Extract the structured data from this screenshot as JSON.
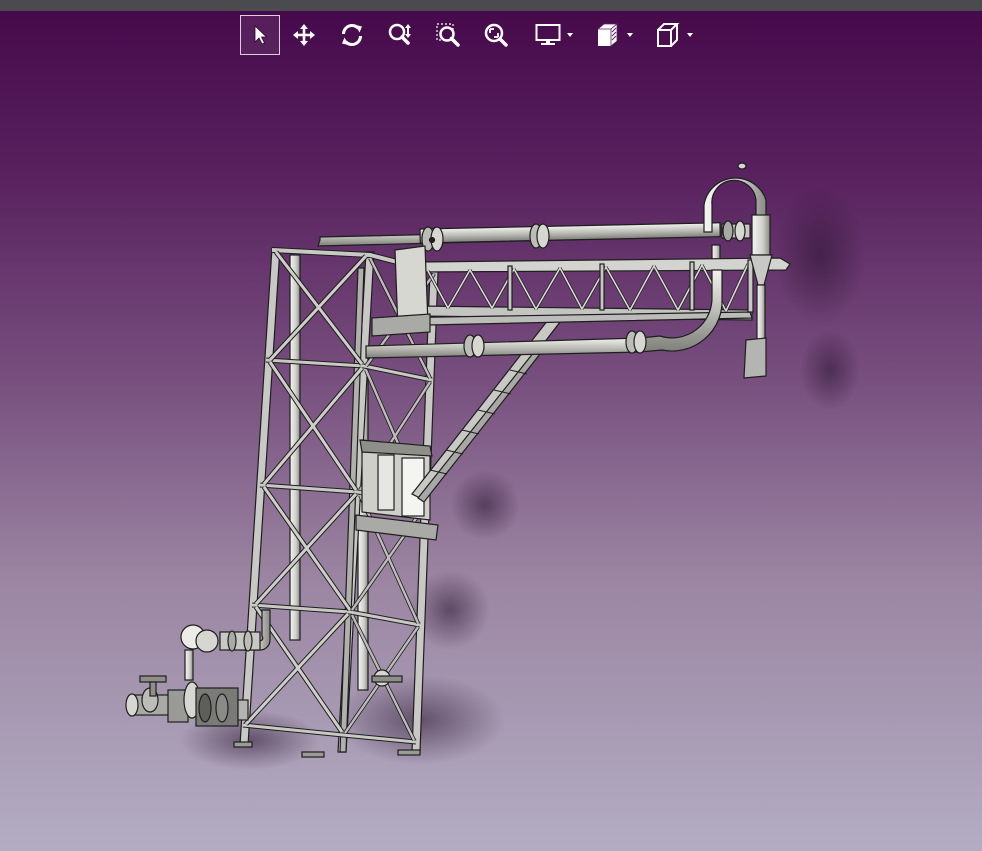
{
  "toolbar": {
    "tools": [
      {
        "name": "select",
        "icon": "pointer-arrow-icon",
        "selected": true
      },
      {
        "name": "pan",
        "icon": "move-arrows-icon"
      },
      {
        "name": "rotate",
        "icon": "rotate-icon"
      },
      {
        "name": "zoom",
        "icon": "zoom-updown-icon"
      },
      {
        "name": "zoom-window",
        "icon": "zoom-window-icon"
      },
      {
        "name": "zoom-fit",
        "icon": "zoom-fit-icon"
      },
      {
        "name": "display-mode",
        "icon": "monitor-icon",
        "has_dropdown": true
      },
      {
        "name": "render-style",
        "icon": "shaded-faces-icon",
        "has_dropdown": true
      },
      {
        "name": "view-orientation",
        "icon": "cube-view-icon",
        "has_dropdown": true
      }
    ]
  },
  "colors": {
    "background_top": "#45084a",
    "background_bottom": "#b3adc3",
    "model_steel": "#c8c8c4",
    "model_edge": "#1e1e1e"
  }
}
